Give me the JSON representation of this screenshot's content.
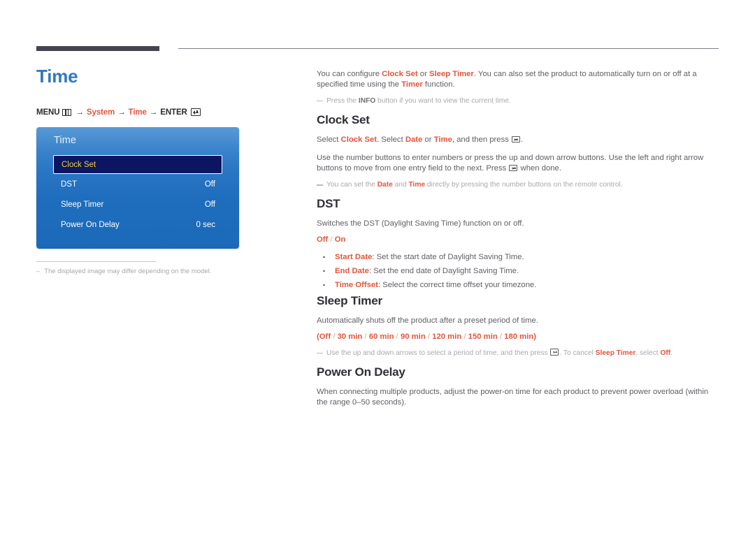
{
  "header": {
    "rule_dark_color": "#454351",
    "rule_thin_color": "#7d7d85"
  },
  "page": {
    "title": "Time",
    "title_color": "#2f7ac0",
    "accent_color": "#e2553a"
  },
  "breadcrumb": {
    "menu_label": "MENU",
    "menu_icon": "menu-grid-icon",
    "arrow": "→",
    "step_system": "System",
    "step_time": "Time",
    "enter_label": "ENTER",
    "enter_icon": "enter-return-icon"
  },
  "osd": {
    "title": "Time",
    "rows": [
      {
        "label": "Clock Set",
        "value": "",
        "selected": true
      },
      {
        "label": "DST",
        "value": "Off",
        "selected": false
      },
      {
        "label": "Sleep Timer",
        "value": "Off",
        "selected": false
      },
      {
        "label": "Power On Delay",
        "value": "0 sec",
        "selected": false
      }
    ],
    "selected_bg": "#0b1560",
    "selected_text": "#f2cf3d"
  },
  "left_note": {
    "dash": "–",
    "text": "The displayed image may differ depending on the model."
  },
  "intro": {
    "p1_a": "You can configure ",
    "p1_b1": "Clock Set",
    "p1_b": " or ",
    "p1_b2": "Sleep Timer",
    "p1_c": ". You can also set the product to automatically turn on or off at a specified time using the ",
    "p1_b3": "Timer",
    "p1_d": " function.",
    "note_a": "Press the ",
    "note_b": "INFO",
    "note_c": " button if you want to view the current time."
  },
  "clock_set": {
    "heading": "Clock Set",
    "p1_a": "Select ",
    "p1_b1": "Clock Set",
    "p1_b": ". Select ",
    "p1_b2": "Date",
    "p1_c": " or ",
    "p1_b3": "Time",
    "p1_d": ", and then press ",
    "p1_e": ".",
    "p2_a": "Use the number buttons to enter numbers or press the up and down arrow buttons. Use the left and right arrow buttons to move from one entry field to the next. Press ",
    "p2_b": " when done.",
    "note_a": "You can set the ",
    "note_b1": "Date",
    "note_b": " and ",
    "note_b2": "Time",
    "note_c": " directly by pressing the number buttons on the remote control."
  },
  "dst": {
    "heading": "DST",
    "p1": "Switches the DST (Daylight Saving Time) function on or off.",
    "options": "Off / On",
    "option_off": "Off",
    "option_sep": " / ",
    "option_on": "On",
    "bullets": [
      {
        "term": "Start Date",
        "desc": ": Set the start date of Daylight Saving Time."
      },
      {
        "term": "End Date",
        "desc": ": Set the end date of Daylight Saving Time."
      },
      {
        "term": "Time Offset",
        "desc": ": Select the correct time offset your timezone."
      }
    ]
  },
  "sleep_timer": {
    "heading": "Sleep Timer",
    "p1": "Automatically shuts off the product after a preset period of time.",
    "values_open": "(",
    "values": [
      "Off",
      "30 min",
      "60 min",
      "90 min",
      "120 min",
      "150 min",
      "180 min"
    ],
    "values_sep": " / ",
    "values_close": ")",
    "note_a": "Use the up and down arrows to select a period of time, and then press ",
    "note_b": ". To cancel ",
    "note_b1": "Sleep Timer",
    "note_c": ", select ",
    "note_b2": "Off",
    "note_d": "."
  },
  "power_on_delay": {
    "heading": "Power On Delay",
    "p1": "When connecting multiple products, adjust the power-on time for each product to prevent power overload (within the range 0–50 seconds)."
  }
}
